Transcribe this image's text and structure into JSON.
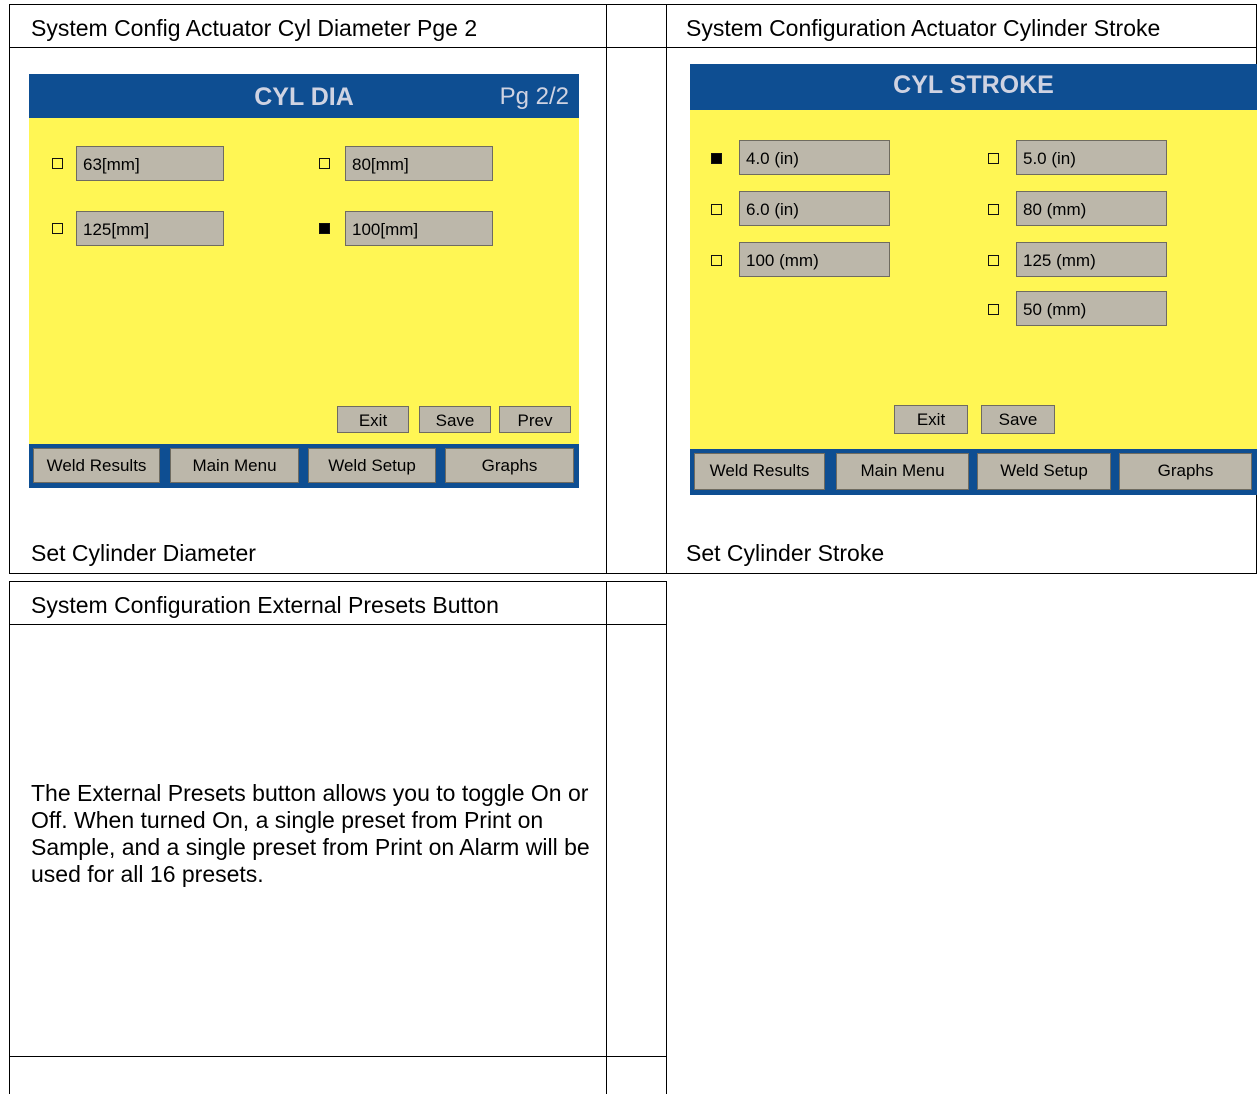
{
  "row1": {
    "left_header": "System Config Actuator Cyl Diameter Pge 2",
    "right_header": "System Configuration Actuator Cylinder Stroke",
    "left_caption": "Set Cylinder Diameter",
    "right_caption": "Set Cylinder Stroke"
  },
  "row2": {
    "left_header": "System Configuration External Presets Button",
    "paragraph": "The External Presets button allows you to toggle On or Off. When turned On, a single preset from Print on Sample, and a single preset from Print on Alarm will be used for all 16 presets."
  },
  "cyl_dia": {
    "title": "CYL DIA",
    "page": "Pg 2/2",
    "options": [
      {
        "label": "63[mm]",
        "checked": false
      },
      {
        "label": "80[mm]",
        "checked": false
      },
      {
        "label": "125[mm]",
        "checked": false
      },
      {
        "label": "100[mm]",
        "checked": true
      }
    ],
    "buttons": {
      "exit": "Exit",
      "save": "Save",
      "prev": "Prev"
    },
    "nav": [
      "Weld Results",
      "Main Menu",
      "Weld Setup",
      "Graphs"
    ]
  },
  "cyl_stroke": {
    "title": "CYL STROKE",
    "options": [
      {
        "label": "4.0 (in)",
        "checked": true
      },
      {
        "label": "5.0 (in)",
        "checked": false
      },
      {
        "label": "6.0 (in)",
        "checked": false
      },
      {
        "label": "80 (mm)",
        "checked": false
      },
      {
        "label": "100 (mm)",
        "checked": false
      },
      {
        "label": "125 (mm)",
        "checked": false
      },
      {
        "label": "50 (mm)",
        "checked": false
      }
    ],
    "buttons": {
      "exit": "Exit",
      "save": "Save"
    },
    "nav": [
      "Weld Results",
      "Main Menu",
      "Weld Setup",
      "Graphs"
    ]
  },
  "colors": {
    "screen_bg": "#fff654",
    "title_bar": "#0e4e92",
    "title_text": "#cfd3e2",
    "button_bg": "#bcb7aa"
  }
}
